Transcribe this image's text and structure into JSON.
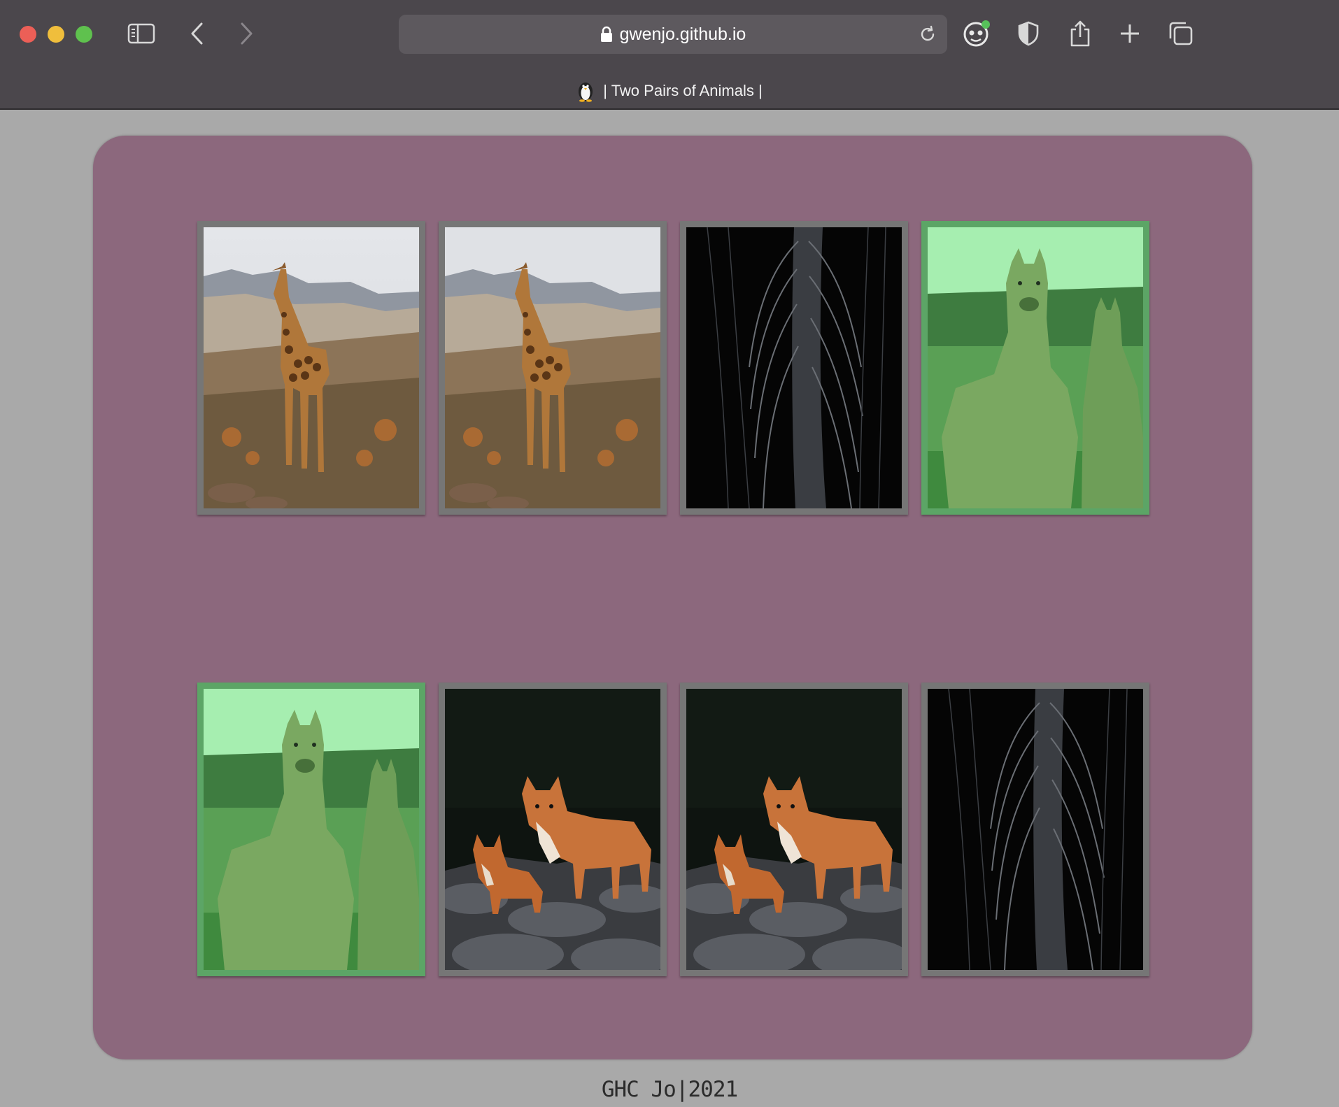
{
  "browser": {
    "url": "gwenjo.github.io",
    "tab_title": "| Two Pairs of Animals |",
    "icons": [
      "sidebar-icon",
      "back-icon",
      "forward-icon",
      "lock-icon",
      "reload-icon",
      "extension-icon",
      "shield-icon",
      "share-icon",
      "new-tab-icon",
      "tabs-overview-icon"
    ]
  },
  "game": {
    "cards": [
      {
        "animal": "giraffe",
        "state": "face-up"
      },
      {
        "animal": "giraffe",
        "state": "face-up"
      },
      {
        "animal": "feather",
        "state": "face-down"
      },
      {
        "animal": "alpaca",
        "state": "matched"
      },
      {
        "animal": "alpaca",
        "state": "matched"
      },
      {
        "animal": "fox",
        "state": "face-up"
      },
      {
        "animal": "fox",
        "state": "face-up"
      },
      {
        "animal": "feather",
        "state": "face-down"
      }
    ]
  },
  "footer": {
    "text": "GHC Jo|2021"
  },
  "colors": {
    "page_bg": "#a9a9a9",
    "board_bg": "#8c687d",
    "card_border": "#767676",
    "matched_border": "#5ca566",
    "chrome_bg": "#4b474c"
  }
}
